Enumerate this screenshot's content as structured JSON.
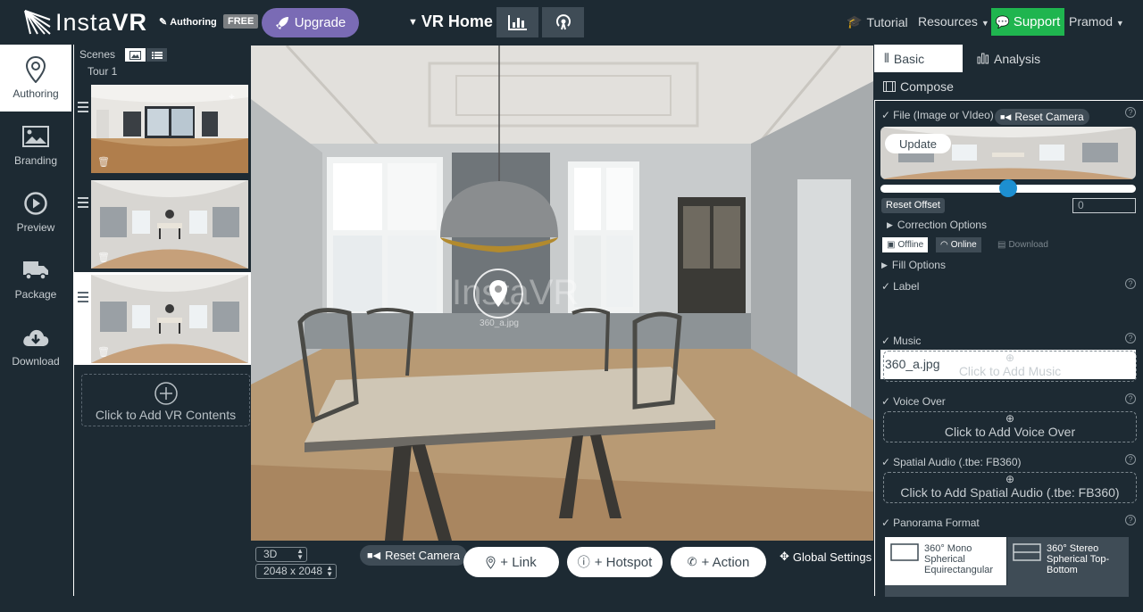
{
  "app": {
    "logo_prefix": "Insta",
    "logo_suffix": "VR",
    "mode_label": "Authoring",
    "plan_badge": "FREE",
    "upgrade_label": "Upgrade",
    "project_title": "VR Home",
    "tutorial_label": "Tutorial",
    "resources_label": "Resources",
    "support_label": "Support",
    "user_name": "Pramod"
  },
  "nav": {
    "items": [
      {
        "label": "Authoring",
        "icon": "map-pin-icon",
        "active": true
      },
      {
        "label": "Branding",
        "icon": "image-icon"
      },
      {
        "label": "Preview",
        "icon": "play-circle-icon"
      },
      {
        "label": "Package",
        "icon": "truck-icon"
      },
      {
        "label": "Download",
        "icon": "cloud-download-icon"
      }
    ]
  },
  "scenes": {
    "header": "Scenes",
    "tour_label": "Tour 1",
    "add_label": "Click to Add VR Contents",
    "selected_index": 2
  },
  "viewer": {
    "watermark": "InstaVR",
    "hotspot_label": "360_a.jpg",
    "stereo_mode": "3D",
    "resolution": "2048 x 2048",
    "reset_camera_label": "Reset Camera",
    "add_link_label": "+ Link",
    "add_hotspot_label": "+ Hotspot",
    "add_action_label": "+ Action",
    "global_settings_label": "Global Settings"
  },
  "right_panel": {
    "tabs": {
      "basic": "Basic",
      "analysis": "Analysis",
      "compose": "Compose"
    },
    "file_label": "File (Image or VIdeo)",
    "reset_camera_label": "Reset Camera",
    "update_label": "Update",
    "reset_offset_label": "Reset Offset",
    "offset_value": "0",
    "correction_label": "Correction Options",
    "offline_label": "Offline",
    "online_label": "Online",
    "download_label": "Download",
    "fill_label": "Fill Options",
    "label_title": "Label",
    "label_value": "360_a.jpg",
    "music_title": "Music",
    "music_add": "Click to Add Music",
    "voice_title": "Voice Over",
    "voice_add": "Click to Add Voice Over",
    "spatial_title": "Spatial Audio (.tbe: FB360)",
    "spatial_add": "Click to Add Spatial Audio (.tbe: FB360)",
    "pano_title": "Panorama Format",
    "pano_mono": "360° Mono Spherical Equirectangular",
    "pano_stereo": "360° Stereo Spherical Top-Bottom",
    "help_glyph": "?",
    "offset_slider_fraction": 0.5
  },
  "colors": {
    "background": "#1d2a33",
    "upgrade": "#7a6bb5",
    "support": "#1fb54f",
    "slider_thumb": "#1d8fd1"
  }
}
